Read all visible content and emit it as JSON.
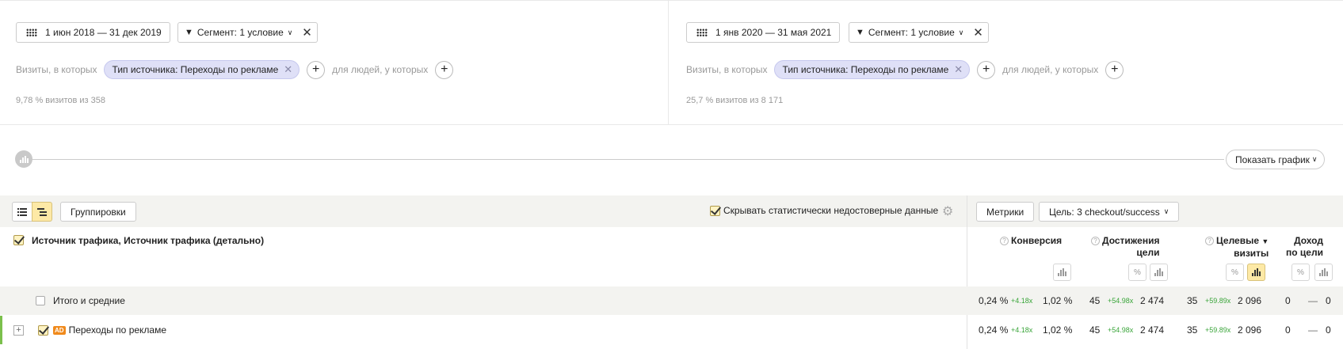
{
  "segments": {
    "left": {
      "date_range": "1 июн 2018 — 31 дек 2019",
      "segment_label": "Сегмент: 1 условие",
      "visits_label": "Визиты, в которых",
      "chip_label": "Тип источника: Переходы по рекламе",
      "people_label": "для людей, у которых",
      "stats": "9,78 % визитов из 358"
    },
    "right": {
      "date_range": "1 янв 2020 — 31 мая 2021",
      "segment_label": "Сегмент: 1 условие",
      "visits_label": "Визиты, в которых",
      "chip_label": "Тип источника: Переходы по рекламе",
      "people_label": "для людей, у которых",
      "stats": "25,7 % визитов из 8 171"
    }
  },
  "graph": {
    "show_label": "Показать график"
  },
  "toolbar": {
    "groupings_label": "Группировки",
    "hide_unreliable_label": "Скрывать статистически недостоверные данные",
    "metrics_label": "Метрики",
    "goal_label": "Цель: 3 checkout/success"
  },
  "table": {
    "dimension_title": "Источник трафика, Источник трафика (детально)",
    "columns": {
      "conversion": "Конверсия",
      "goal_reaches_1": "Достижения",
      "goal_reaches_2": "цели",
      "target_visits_1": "Целевые",
      "target_visits_2": "визиты",
      "target_visits_sort": "▼",
      "revenue_1": "Доход",
      "revenue_2": "по цели"
    },
    "mini_percent": "%",
    "rows": [
      {
        "label": "Итого и средние",
        "conv_a": "0,24 %",
        "conv_delta": "+4.18x",
        "conv_b": "1,02 %",
        "reach_a": "45",
        "reach_delta": "+54.98x",
        "reach_b": "2 474",
        "tv_a": "35",
        "tv_delta": "+59.89x",
        "tv_b": "2 096",
        "rev_a": "0",
        "rev_delta": "—",
        "rev_b": "0"
      },
      {
        "label": "Переходы по рекламе",
        "badge": "AD",
        "conv_a": "0,24 %",
        "conv_delta": "+4.18x",
        "conv_b": "1,02 %",
        "reach_a": "45",
        "reach_delta": "+54.98x",
        "reach_b": "2 474",
        "tv_a": "35",
        "tv_delta": "+59.89x",
        "tv_b": "2 096",
        "rev_a": "0",
        "rev_delta": "—",
        "rev_b": "0"
      }
    ]
  },
  "icons": {
    "x": "✕",
    "plus": "+",
    "chevron": "⌵",
    "funnel": "⏷",
    "gear": "⚙"
  },
  "colors": {
    "chip_bg": "#dfe0f7",
    "active_yellow": "#fde9a6",
    "delta_green": "#3aa53a",
    "ad_orange": "#f08a1c",
    "row_accent": "#7bc04c"
  }
}
